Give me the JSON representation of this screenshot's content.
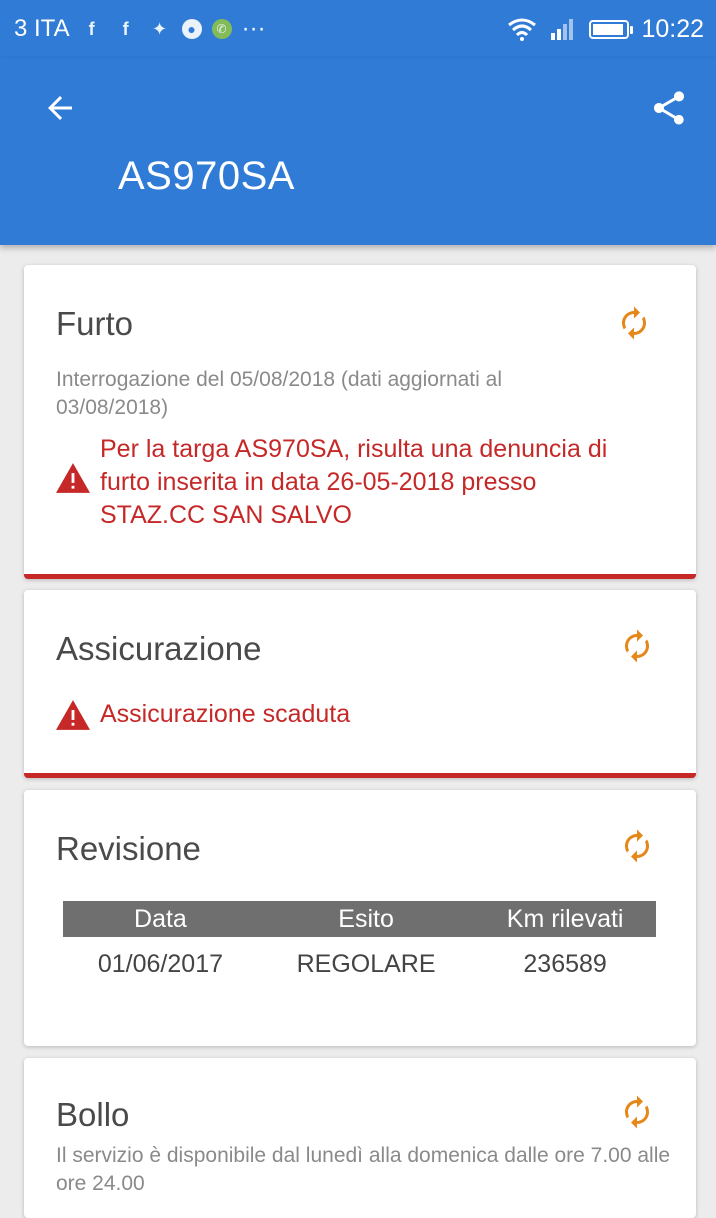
{
  "status_bar": {
    "carrier": "3 ITA",
    "time": "10:22",
    "icons": [
      "facebook-icon",
      "facebook-icon",
      "notification-icon",
      "chrome-icon",
      "whatsapp-icon",
      "more-dots-icon",
      "wifi-icon",
      "signal-icon",
      "battery-icon"
    ],
    "more_dots": "···"
  },
  "app_bar": {
    "plate": "AS970SA",
    "back_icon": "arrow-back-icon",
    "share_icon": "share-icon"
  },
  "colors": {
    "primary": "#2f7bd6",
    "alert_red": "#c62828",
    "refresh_orange": "#e6871a",
    "table_header": "#6f6f6f"
  },
  "cards": {
    "furto": {
      "title": "Furto",
      "subtitle": "Interrogazione del 05/08/2018 (dati aggiornati al 03/08/2018)",
      "warning": "Per la targa AS970SA, risulta una denuncia di furto inserita in data 26-05-2018 presso STAZ.CC SAN SALVO"
    },
    "assicurazione": {
      "title": "Assicurazione",
      "warning": "Assicurazione scaduta"
    },
    "revisione": {
      "title": "Revisione",
      "columns": [
        "Data",
        "Esito",
        "Km rilevati"
      ],
      "rows": [
        [
          "01/06/2017",
          "REGOLARE",
          "236589"
        ]
      ]
    },
    "bollo": {
      "title": "Bollo",
      "subtitle": "Il servizio è disponibile dal lunedì alla domenica dalle ore 7.00 alle ore 24.00"
    }
  }
}
